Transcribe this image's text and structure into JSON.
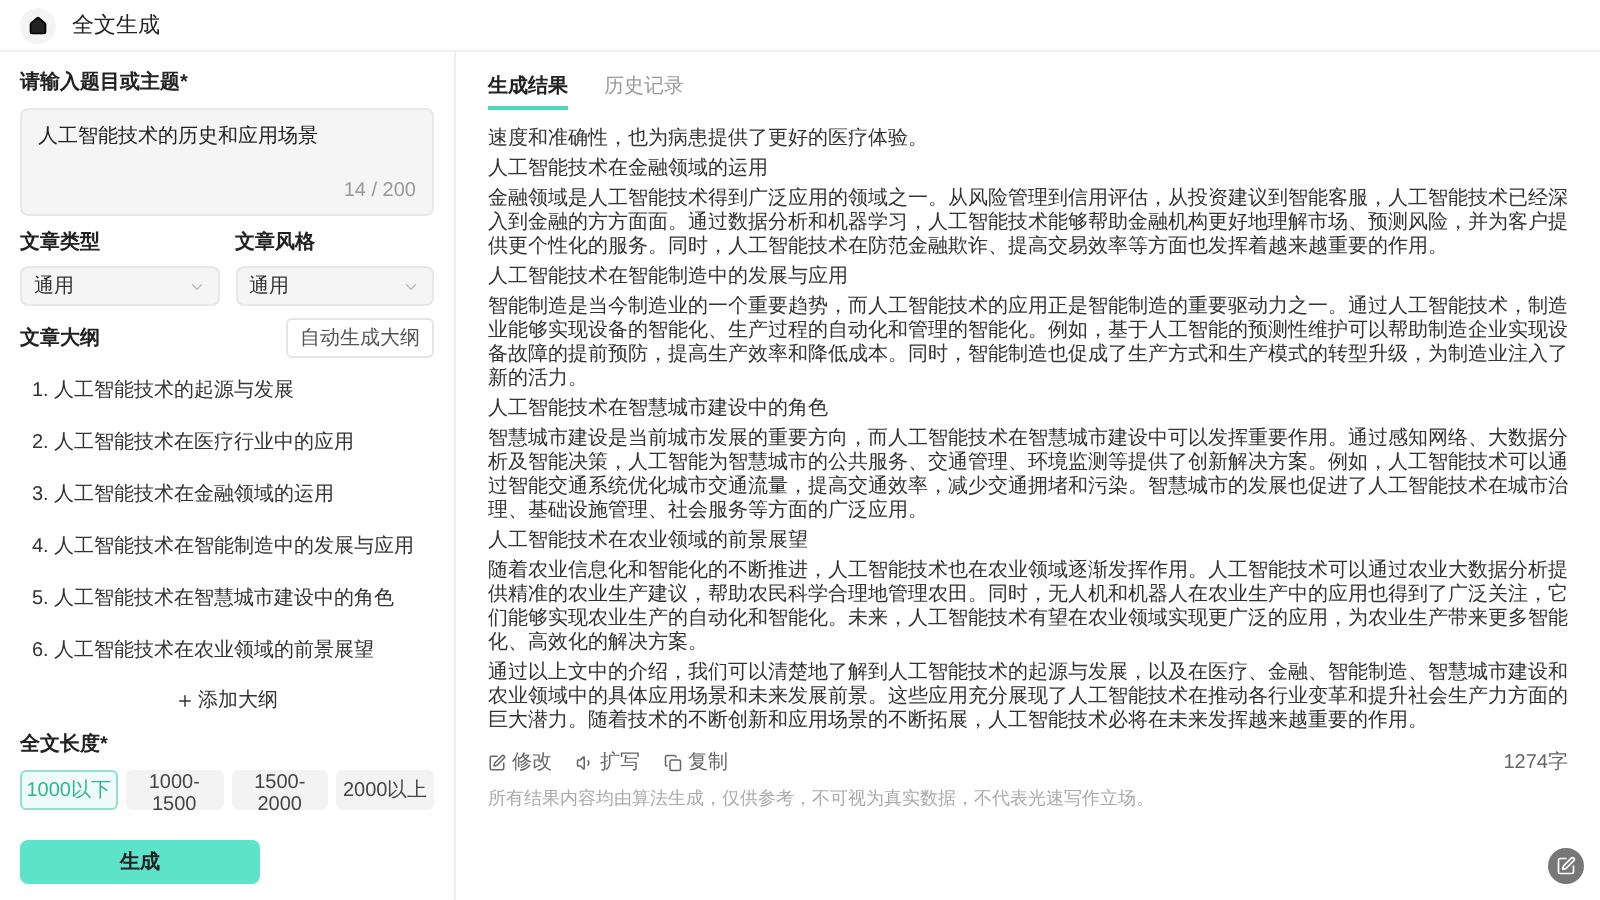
{
  "header": {
    "title": "全文生成"
  },
  "topic": {
    "label": "请输入题目或主题*",
    "value": "人工智能技术的历史和应用场景",
    "counter": "14 / 200"
  },
  "selects": [
    {
      "label": "文章类型",
      "value": "通用"
    },
    {
      "label": "文章风格",
      "value": "通用"
    }
  ],
  "outline": {
    "label": "文章大纲",
    "auto_button": "自动生成大纲",
    "items": [
      "1. 人工智能技术的起源与发展",
      "2. 人工智能技术在医疗行业中的应用",
      "3. 人工智能技术在金融领域的运用",
      "4. 人工智能技术在智能制造中的发展与应用",
      "5. 人工智能技术在智慧城市建设中的角色",
      "6. 人工智能技术在农业领域的前景展望"
    ],
    "add_button": "添加大纲"
  },
  "length": {
    "label": "全文长度*",
    "options": [
      {
        "label": "1000以下",
        "selected": true
      },
      {
        "label": "1000-1500",
        "selected": false
      },
      {
        "label": "1500-2000",
        "selected": false
      },
      {
        "label": "2000以上",
        "selected": false
      }
    ]
  },
  "generate_button": "生成",
  "result": {
    "tabs": [
      {
        "label": "生成结果",
        "selected": true
      },
      {
        "label": "历史记录",
        "selected": false
      }
    ],
    "paragraphs": [
      "速度和准确性，也为病患提供了更好的医疗体验。",
      "人工智能技术在金融领域的运用",
      "金融领域是人工智能技术得到广泛应用的领域之一。从风险管理到信用评估，从投资建议到智能客服，人工智能技术已经深入到金融的方方面面。通过数据分析和机器学习，人工智能技术能够帮助金融机构更好地理解市场、预测风险，并为客户提供更个性化的服务。同时，人工智能技术在防范金融欺诈、提高交易效率等方面也发挥着越来越重要的作用。",
      "人工智能技术在智能制造中的发展与应用",
      "智能制造是当今制造业的一个重要趋势，而人工智能技术的应用正是智能制造的重要驱动力之一。通过人工智能技术，制造业能够实现设备的智能化、生产过程的自动化和管理的智能化。例如，基于人工智能的预测性维护可以帮助制造企业实现设备故障的提前预防，提高生产效率和降低成本。同时，智能制造也促成了生产方式和生产模式的转型升级，为制造业注入了新的活力。",
      "人工智能技术在智慧城市建设中的角色",
      "智慧城市建设是当前城市发展的重要方向，而人工智能技术在智慧城市建设中可以发挥重要作用。通过感知网络、大数据分析及智能决策，人工智能为智慧城市的公共服务、交通管理、环境监测等提供了创新解决方案。例如，人工智能技术可以通过智能交通系统优化城市交通流量，提高交通效率，减少交通拥堵和污染。智慧城市的发展也促进了人工智能技术在城市治理、基础设施管理、社会服务等方面的广泛应用。",
      "人工智能技术在农业领域的前景展望",
      "随着农业信息化和智能化的不断推进，人工智能技术也在农业领域逐渐发挥作用。人工智能技术可以通过农业大数据分析提供精准的农业生产建议，帮助农民科学合理地管理农田。同时，无人机和机器人在农业生产中的应用也得到了广泛关注，它们能够实现农业生产的自动化和智能化。未来，人工智能技术有望在农业领域实现更广泛的应用，为农业生产带来更多智能化、高效化的解决方案。",
      "通过以上文中的介绍，我们可以清楚地了解到人工智能技术的起源与发展，以及在医疗、金融、智能制造、智慧城市建设和农业领域中的具体应用场景和未来发展前景。这些应用充分展现了人工智能技术在推动各行业变革和提升社会生产力方面的巨大潜力。随着技术的不断创新和应用场景的不断拓展，人工智能技术必将在未来发挥越来越重要的作用。"
    ],
    "actions": [
      "修改",
      "扩写",
      "复制"
    ],
    "word_count": "1274字",
    "disclaimer": "所有结果内容均由算法生成，仅供参考，不可视为真实数据，不代表光速写作立场。"
  }
}
